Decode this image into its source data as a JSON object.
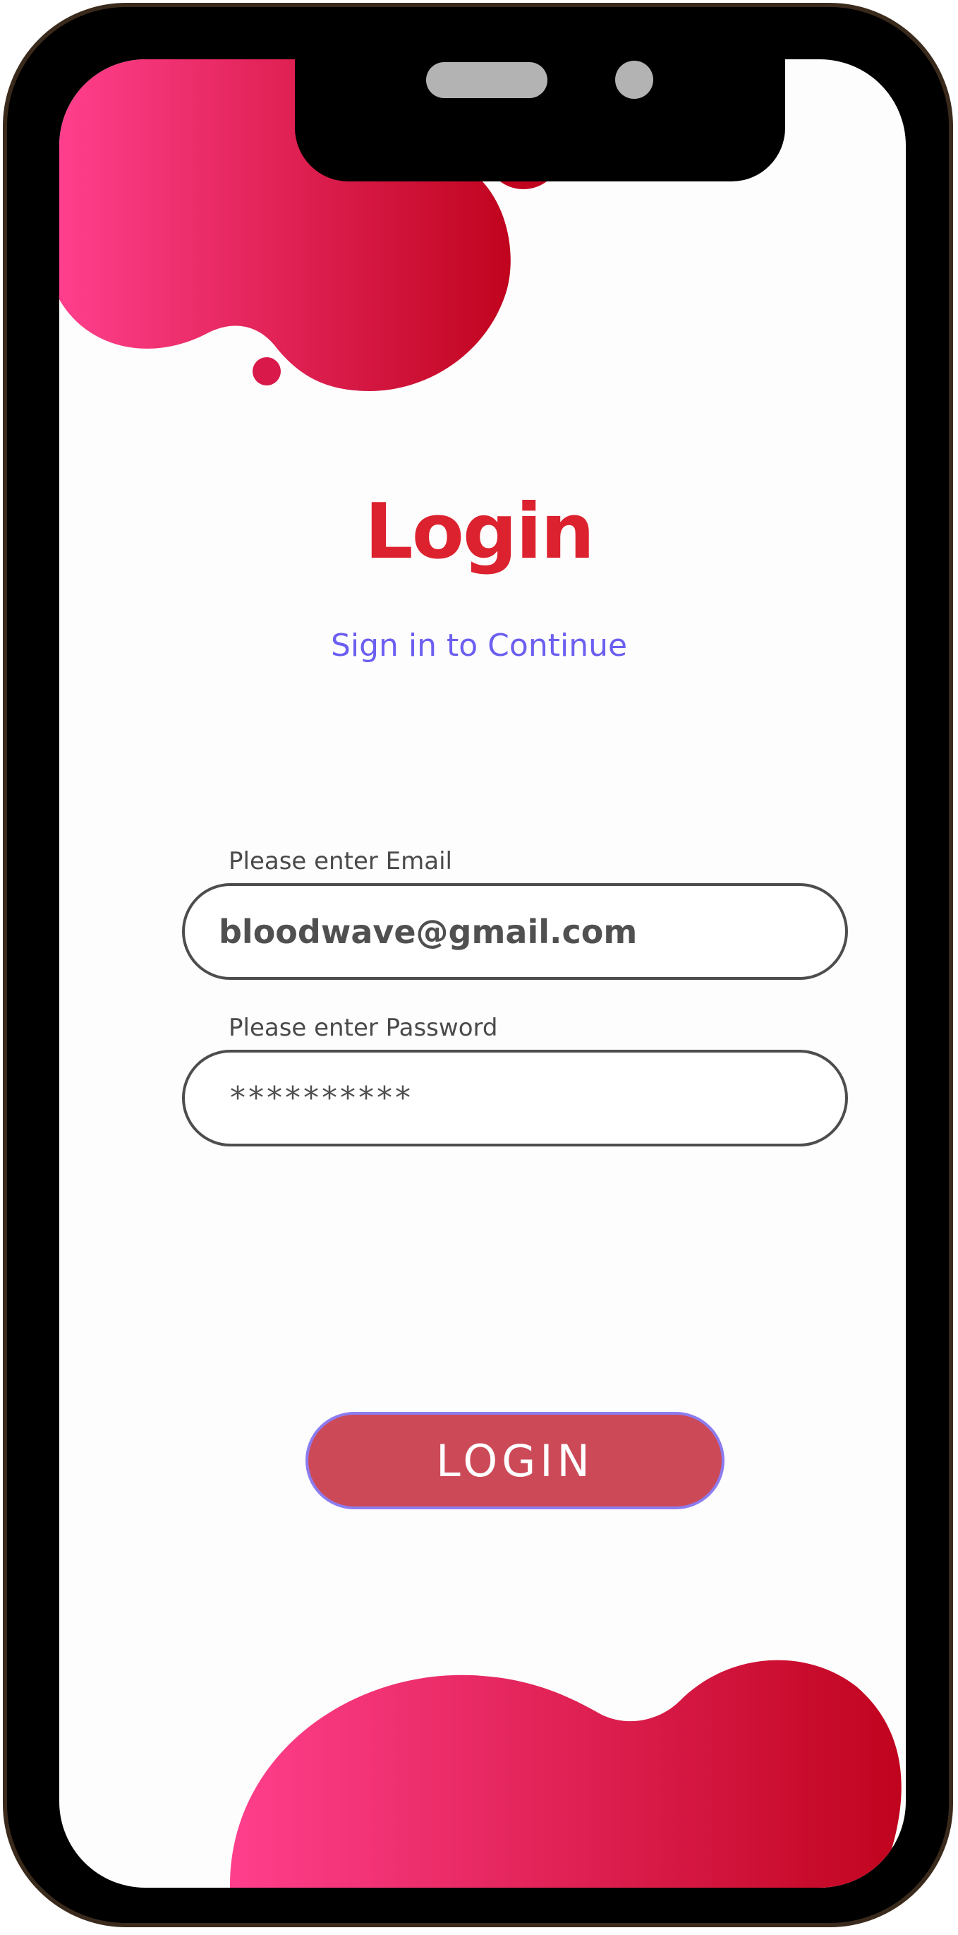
{
  "colors": {
    "blob_light": "#ff3f8c",
    "blob_dark": "#c0041e",
    "title": "#dc222e",
    "subtitle": "#6c5ff0",
    "button": "#cc4a58",
    "button_border": "#8c7cf0",
    "field_border": "#4d4d4d"
  },
  "login": {
    "title": "Login",
    "subtitle": "Sign in to Continue",
    "email": {
      "label": "Please enter Email",
      "value": "bloodwave@gmail.com"
    },
    "password": {
      "label": "Please enter Password",
      "value": "**********"
    },
    "button_label": "LOGIN"
  }
}
